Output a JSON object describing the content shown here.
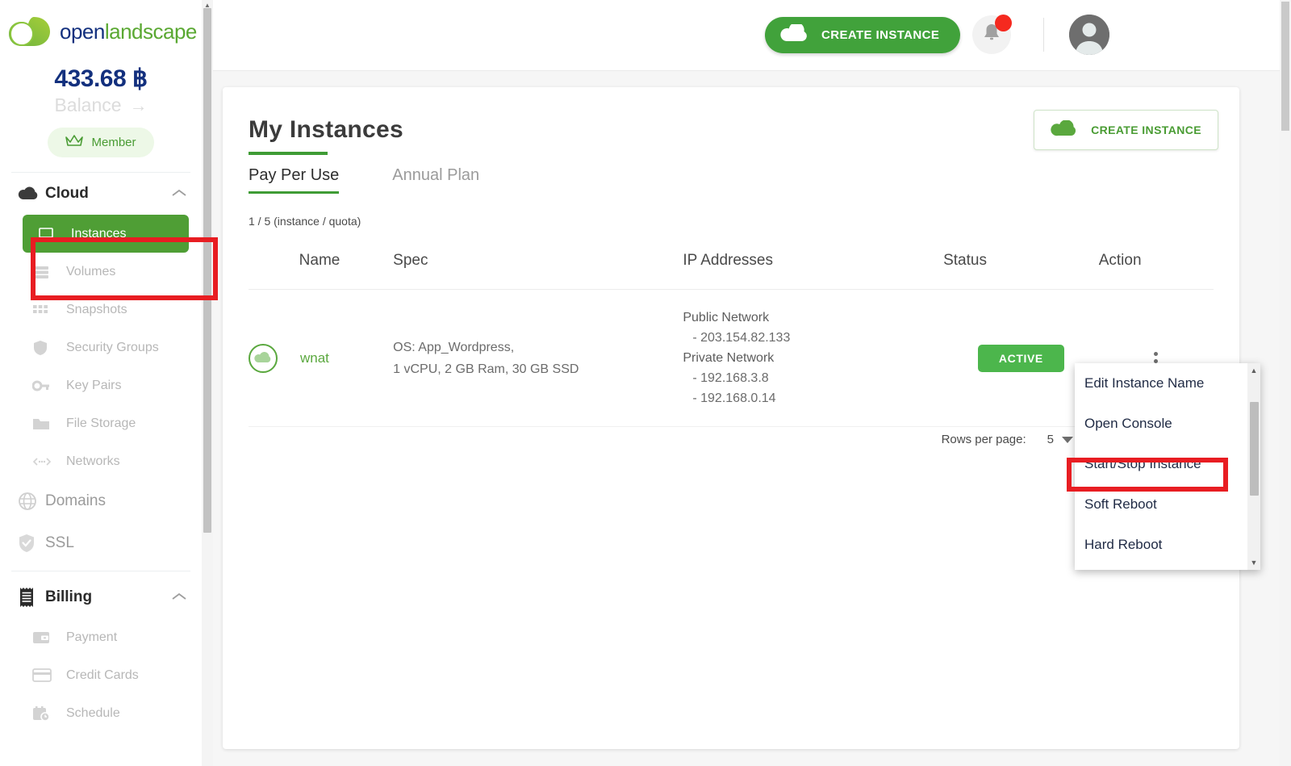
{
  "brand": {
    "logo_text_part1": "open",
    "logo_text_part2": "landscape",
    "green": "#5aa832",
    "navy": "#13307e",
    "primary_green": "#41a23b",
    "badge_green": "#4cb64c",
    "highlight_red": "#e81d22"
  },
  "sidebar": {
    "balance_amount": "433.68 ฿",
    "balance_label": "Balance",
    "balance_arrow": "→",
    "member_chip": "Member",
    "crown_icon": "crown-icon",
    "groups": [
      {
        "label": "Cloud",
        "icon": "cloud-icon",
        "expanded": true,
        "chevron": "chevron-up-icon",
        "items": [
          {
            "label": "Instances",
            "icon": "laptop-icon",
            "active": true
          },
          {
            "label": "Volumes",
            "icon": "volumes-icon",
            "active": false
          },
          {
            "label": "Snapshots",
            "icon": "snapshots-icon",
            "active": false
          },
          {
            "label": "Security Groups",
            "icon": "shield-icon",
            "active": false
          },
          {
            "label": "Key Pairs",
            "icon": "key-icon",
            "active": false
          },
          {
            "label": "File Storage",
            "icon": "folder-icon",
            "active": false
          },
          {
            "label": "Networks",
            "icon": "network-icon",
            "active": false
          }
        ]
      }
    ],
    "top_links": [
      {
        "label": "Domains",
        "icon": "globe-icon"
      },
      {
        "label": "SSL",
        "icon": "shield-check-icon"
      }
    ],
    "billing": {
      "label": "Billing",
      "icon": "receipt-icon",
      "expanded": true,
      "chevron": "chevron-up-icon",
      "items": [
        {
          "label": "Payment",
          "icon": "wallet-icon"
        },
        {
          "label": "Credit Cards",
          "icon": "credit-card-icon"
        },
        {
          "label": "Schedule",
          "icon": "schedule-icon"
        }
      ]
    }
  },
  "header": {
    "create_instance_label": "CREATE INSTANCE",
    "cloud_icon": "cloud-icon",
    "bell_icon": "bell-icon",
    "notification_badge": "",
    "avatar_icon": "user-avatar-icon"
  },
  "main": {
    "page_title": "My Instances",
    "create_instance_label": "CREATE INSTANCE",
    "tabs": [
      {
        "label": "Pay Per Use",
        "selected": true
      },
      {
        "label": "Annual Plan",
        "selected": false
      }
    ],
    "quota_text": "1 / 5 (instance / quota)",
    "table": {
      "headers": [
        "",
        "Name",
        "Spec",
        "IP Addresses",
        "Status",
        "Action"
      ],
      "rows": [
        {
          "icon": "cloud-instance-icon",
          "name": "wnat",
          "spec_line1": "OS: App_Wordpress,",
          "spec_line2": "1 vCPU, 2 GB Ram, 30 GB SSD",
          "ip_public_label": "Public Network",
          "ip_public_value": "- 203.154.82.133",
          "ip_private_label": "Private Network",
          "ip_private_value1": "- 192.168.3.8",
          "ip_private_value2": "- 192.168.0.14",
          "status": "ACTIVE",
          "action_icon": "kebab-menu-icon"
        }
      ]
    },
    "rows_per_page_label": "Rows per page:",
    "rows_per_page_value": "5"
  },
  "action_menu": {
    "items": [
      {
        "label": "Edit Instance Name",
        "highlighted": false
      },
      {
        "label": "Open Console",
        "highlighted": false
      },
      {
        "label": "Start/Stop Instance",
        "highlighted": true
      },
      {
        "label": "Soft Reboot",
        "highlighted": false
      },
      {
        "label": "Hard Reboot",
        "highlighted": false
      }
    ],
    "scroll_up_arrow": "▲",
    "scroll_down_arrow": "▼"
  }
}
